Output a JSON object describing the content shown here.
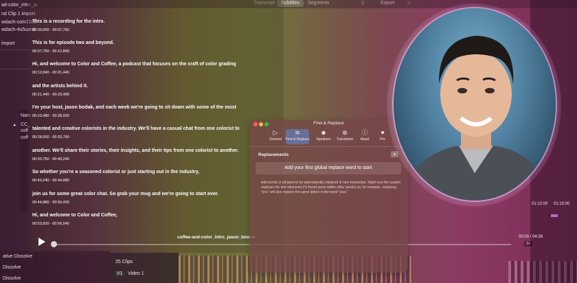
{
  "nle": {
    "left_items": [
      "ad-color_intro_ja",
      "nd Clip 1 import",
      "wdach-com72n9",
      "wdach-4u5uan8",
      "import"
    ],
    "name_header": "Nam",
    "folder_label": "CC_",
    "file_items": [
      "coff",
      "coff"
    ],
    "bottom_items": [
      "ative Dissolve",
      "Dissolve",
      "Dissolve"
    ],
    "clips_count": "25 Clips",
    "track_badge": "V1",
    "track_name": "Video 1",
    "right_time": "01:12:00",
    "right_time2": "01:13:00"
  },
  "transcript": {
    "tabs": [
      "Transcript",
      "Subtitles",
      "Segments"
    ],
    "active_tab": "Subtitles",
    "export_label": "Export",
    "segments": [
      {
        "text": "This is a recording for the intro.",
        "time": "00:00,000 - 00:07,760"
      },
      {
        "text": "This is for episode two and beyond.",
        "time": "00:07,760 - 00:12,840"
      },
      {
        "text": "Hi, and welcome to Color and Coffee, a podcast that focuses on the craft of color grading",
        "time": "00:12,840 - 00:21,440"
      },
      {
        "text": "and the artists behind it.",
        "time": "00:21,440 - 00:23,480"
      },
      {
        "text": "I'm your host, jason bodak, and each week we're going to sit down with some of the most",
        "time": "00:23,480 - 00:28,000"
      },
      {
        "text": "talented and creative colorists in the industry. We'll have a casual chat from one colorist to",
        "time": "00:28,000 - 00:33,760"
      },
      {
        "text": "another. We'll share their stories, their insights, and their tips from one colorist to another.",
        "time": "00:33,760 - 00:40,240"
      },
      {
        "text": "So whether you're a seasoned colorist or just starting out in the industry,",
        "time": "00:40,240 - 00:44,880"
      },
      {
        "text": "join us for some great color chat. So grab your mug and we're going to start over.",
        "time": "00:44,880 - 00:50,400"
      },
      {
        "text": "Hi, and welcome to Color and Coffee,",
        "time": "00:53,920 - 00:56,540"
      }
    ],
    "player": {
      "filename": "coffee-and-color_intro_jason_bowda",
      "timecode": "00:00 / 04:38",
      "speed": "1×",
      "progress": 0.0
    }
  },
  "dialog": {
    "title": "Find & Replace",
    "toolbar": [
      {
        "icon": "▷",
        "label": "General"
      },
      {
        "icon": "≋",
        "label": "Find & Replace"
      },
      {
        "icon": "☻",
        "label": "Speakers"
      },
      {
        "icon": "⊕",
        "label": "Translation"
      },
      {
        "icon": "ⓘ",
        "label": "About"
      },
      {
        "icon": "♥",
        "label": "Pro"
      }
    ],
    "active_tool": "Find & Replace",
    "section_title": "Replacements",
    "add_label": "+",
    "first_word_label": "Add your first global replace word to start",
    "description": "Add words or phrases to be automatically replaced in new transcripts. Right now the system replaces the text whenever it's found (even within other words) so, for example, replacing \"you\" will also replace the same letters in the word \"your.\""
  },
  "colors": {
    "traffic_red": "#ff5f57",
    "traffic_yellow": "#febc2e",
    "traffic_green": "#28c840",
    "active_tool": "#5a8cdc"
  }
}
